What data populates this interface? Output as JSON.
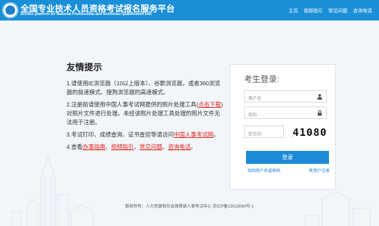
{
  "header": {
    "title": "全国专业技术人员资格考试报名服务平台",
    "subtitle": "Service platform for National Professional and technician qualification test",
    "logo_text": "CTA",
    "nav": [
      "主页",
      "视频指引",
      "常见问题",
      "咨询电话"
    ]
  },
  "notice": {
    "title": "友情提示",
    "item1": "1.请使用IE浏览器（10以上版本）、谷歌浏览器，或者360浏览器的极速模式、搜狗浏览器的高速模式。",
    "item2_a": "2.注册前请使用中国人事考试网提供的照片处理工具(",
    "item2_link": "点击下载",
    "item2_b": ")对照片文件进行处理。未经该照片处理工具处理的照片文件无法用于注册。",
    "item3_a": "3.考试打印、成绩查询、证书查验等请访问",
    "item3_link": "中国人事考试网",
    "item3_b": "。",
    "item4_a": "4.查看",
    "item4_link1": "办事指南",
    "item4_sep1": "、",
    "item4_link2": "视频指引",
    "item4_sep2": "、",
    "item4_link3": "常见问题",
    "item4_sep3": "、",
    "item4_link4": "咨询电话",
    "item4_b": "。"
  },
  "login": {
    "title": "考生登录:",
    "username_placeholder": "用户名",
    "password_placeholder": "密码",
    "captcha_placeholder": "验证码",
    "captcha_text": "41080",
    "login_button": "登录",
    "forgot_link": "找回用户名或密码",
    "register_link": "新用户注册"
  },
  "footer": {
    "text": "版权所有：人力资源和社会保障部人事考试中心 京ICP备13013060号-1"
  },
  "colors": {
    "header_bg": "#1a8fd8",
    "link_red": "#e0231d",
    "login_button": "#1d8ad9"
  }
}
